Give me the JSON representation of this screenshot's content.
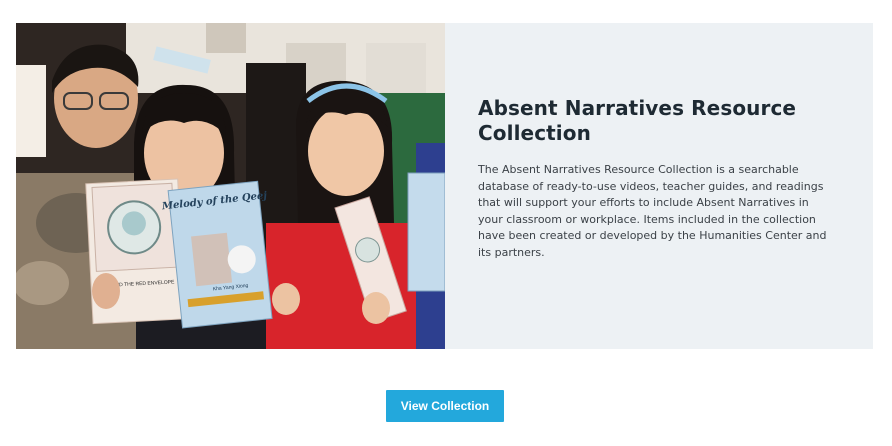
{
  "feature": {
    "title": "Absent Narratives Resource Collection",
    "description": "The Absent Narratives Resource Collection is a searchable database of ready-to-use videos, teacher guides, and readings that will support your efforts to include Absent Narratives in your classroom or workplace. Items included in the collection have been created or developed by the Humanities Center and its partners.",
    "image": {
      "book_left_title": "LINH AND THE RED ENVELOPE",
      "book_right_title": "Melody of the Qeej",
      "book_right_author": "Kha Yang Xiong"
    }
  },
  "cta": {
    "label": "View Collection"
  },
  "colors": {
    "panel_background": "#edf1f4",
    "title_text": "#1e2a33",
    "button_background": "#23a8dc",
    "button_text": "#ffffff"
  }
}
